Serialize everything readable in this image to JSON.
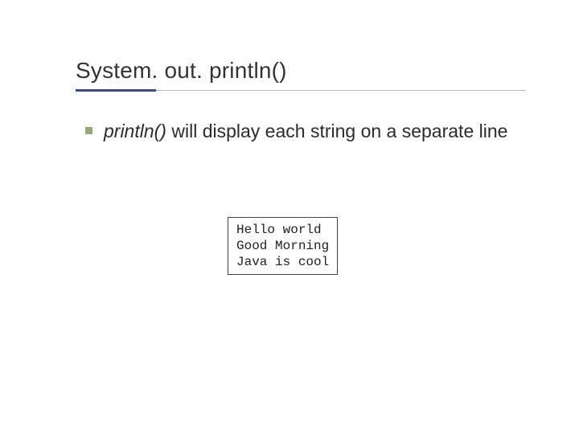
{
  "slide": {
    "title": "System. out. println()",
    "bullet": {
      "method": "println()",
      "rest": " will display each string on a separate line"
    },
    "output": {
      "line1": "Hello world",
      "line2": "Good Morning",
      "line3": "Java is cool"
    }
  }
}
